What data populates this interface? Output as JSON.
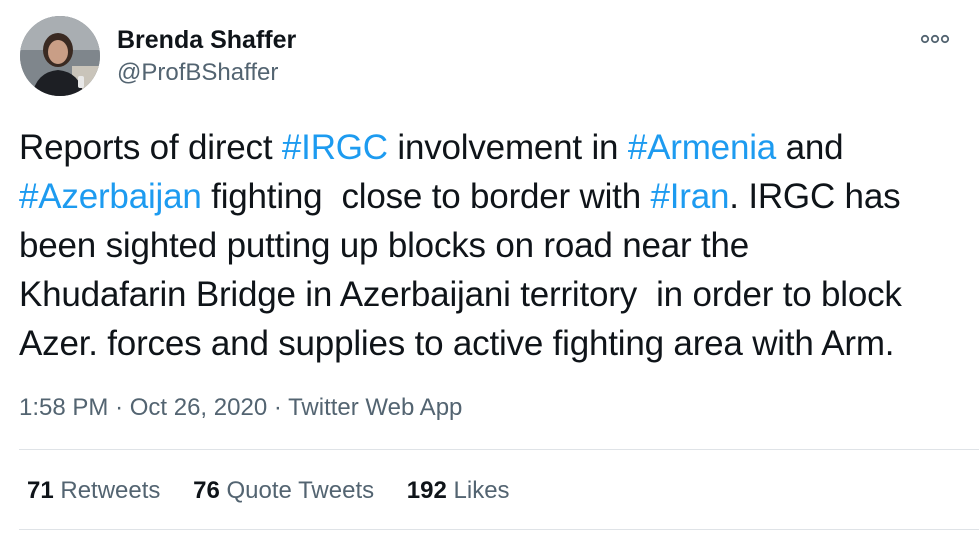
{
  "author": {
    "name": "Brenda Shaffer",
    "handle": "@ProfBShaffer"
  },
  "tweet": {
    "lines": [
      [
        {
          "text": "Reports of direct ",
          "tag": false
        },
        {
          "text": "#IRGC",
          "tag": true
        },
        {
          "text": " involvement in ",
          "tag": false
        },
        {
          "text": "#Armenia",
          "tag": true
        },
        {
          "text": " and",
          "tag": false
        }
      ],
      [
        {
          "text": "#Azerbaijan",
          "tag": true
        },
        {
          "text": " fighting  close to border with ",
          "tag": false
        },
        {
          "text": "#Iran",
          "tag": true
        },
        {
          "text": ". IRGC has",
          "tag": false
        }
      ],
      [
        {
          "text": "been sighted putting up blocks on road near the",
          "tag": false
        }
      ],
      [
        {
          "text": "Khudafarin Bridge in Azerbaijani territory  in order to block",
          "tag": false
        }
      ],
      [
        {
          "text": "Azer. forces and supplies to active fighting area with Arm.",
          "tag": false
        }
      ]
    ]
  },
  "meta": {
    "time": "1:58 PM",
    "separator": "·",
    "date": "Oct 26, 2020",
    "source": "Twitter Web App"
  },
  "stats": {
    "retweets": {
      "count": "71",
      "label": "Retweets"
    },
    "quotes": {
      "count": "76",
      "label": "Quote Tweets"
    },
    "likes": {
      "count": "192",
      "label": "Likes"
    }
  },
  "icons": {
    "more": "more-icon"
  },
  "colors": {
    "hashtag": "#1d9bf0",
    "secondary": "#536471",
    "primary": "#0f1419",
    "divider": "#dfe3e7"
  }
}
